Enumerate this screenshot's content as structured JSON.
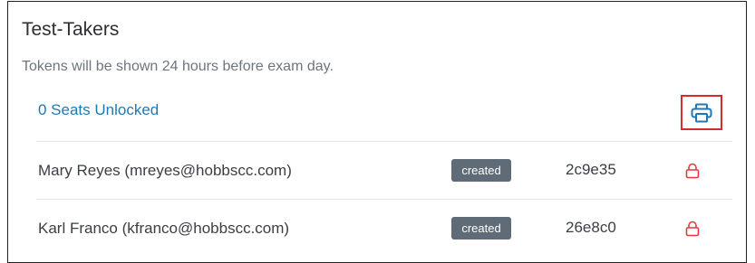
{
  "panel": {
    "title": "Test-Takers",
    "subtitle": "Tokens will be shown 24 hours before exam day.",
    "seats_label": "0 Seats Unlocked"
  },
  "icons": {
    "print": "printer-icon",
    "lock": "lock-icon"
  },
  "colors": {
    "link": "#1f78b4",
    "badge": "#5f6b76",
    "lock": "#e0393e",
    "highlight": "#d62b2b"
  },
  "test_takers": [
    {
      "name": "Mary Reyes (mreyes@hobbscc.com)",
      "status": "created",
      "token": "2c9e35"
    },
    {
      "name": "Karl Franco (kfranco@hobbscc.com)",
      "status": "created",
      "token": "26e8c0"
    }
  ]
}
